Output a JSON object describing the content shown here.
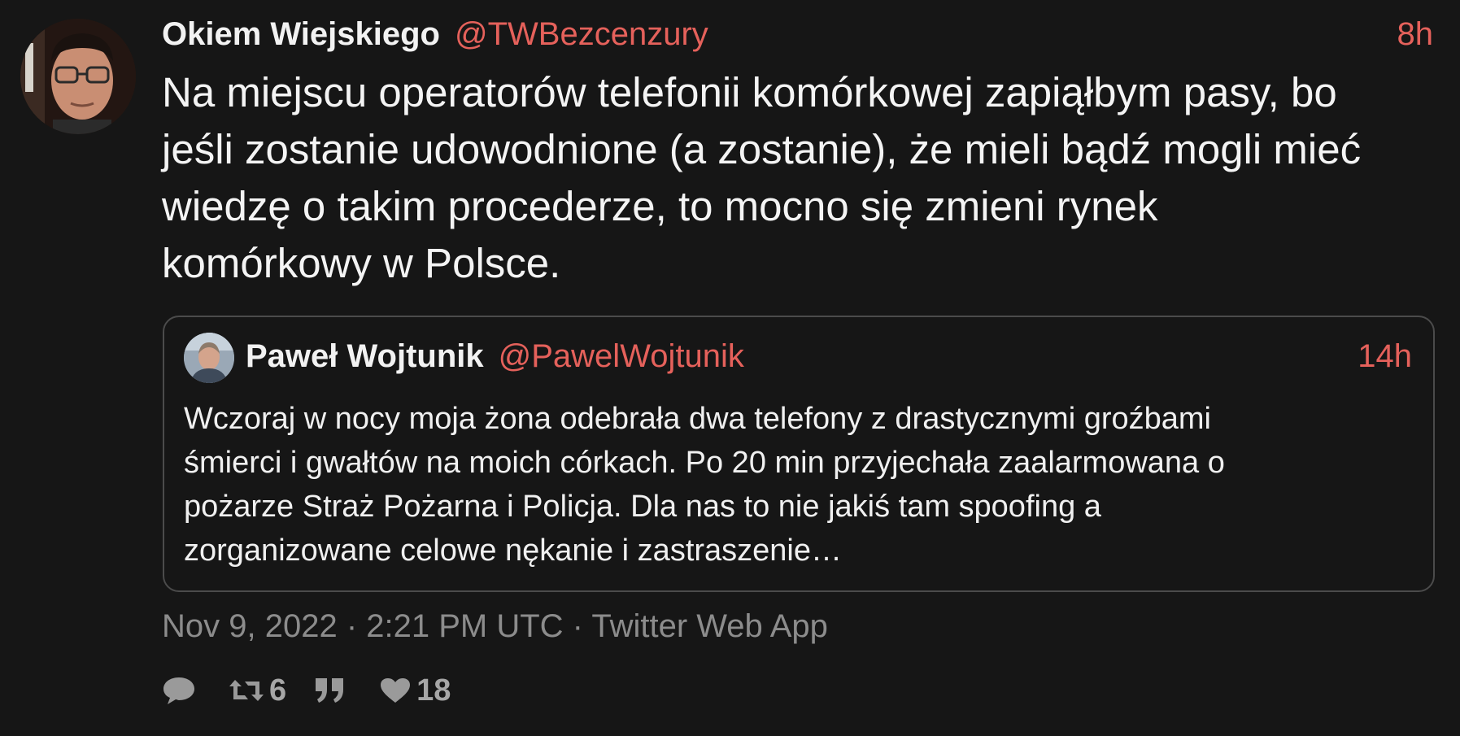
{
  "tweet": {
    "fullname": "Okiem Wiejskiego",
    "username": "@TWBezcenzury",
    "time": "8h",
    "content_lines": [
      "Na miejscu operatorów telefonii komórkowej zapiąłbym pasy, bo",
      "jeśli zostanie udowodnione (a zostanie), że mieli bądź mogli mieć",
      "wiedzę o takim procederze, to mocno się zmieni rynek",
      "komórkowy w Polsce."
    ],
    "published": "Nov 9, 2022 · 2:21 PM UTC · Twitter Web App"
  },
  "quote": {
    "fullname": "Paweł Wojtunik",
    "username": "@PawelWojtunik",
    "time": "14h",
    "text_lines": [
      "Wczoraj w nocy moja żona odebrała dwa telefony z drastycznymi groźbami",
      "śmierci i gwałtów na moich córkach. Po 20 min przyjechała zaalarmowana o",
      "pożarze Straż Pożarna i Policja. Dla nas to nie jakiś tam spoofing a",
      "zorganizowane celowe nękanie i zastraszenie…"
    ]
  },
  "stats": {
    "replies": "",
    "retweets": "6",
    "quotes": "",
    "likes": "18"
  },
  "icons": {
    "reply": "comment-icon",
    "retweet": "retweet-icon",
    "quote": "quote-icon",
    "like": "heart-icon"
  },
  "colors": {
    "background": "#161616",
    "accent": "#e5615b",
    "muted": "#8c8c8c",
    "border": "#4b4b4b"
  }
}
